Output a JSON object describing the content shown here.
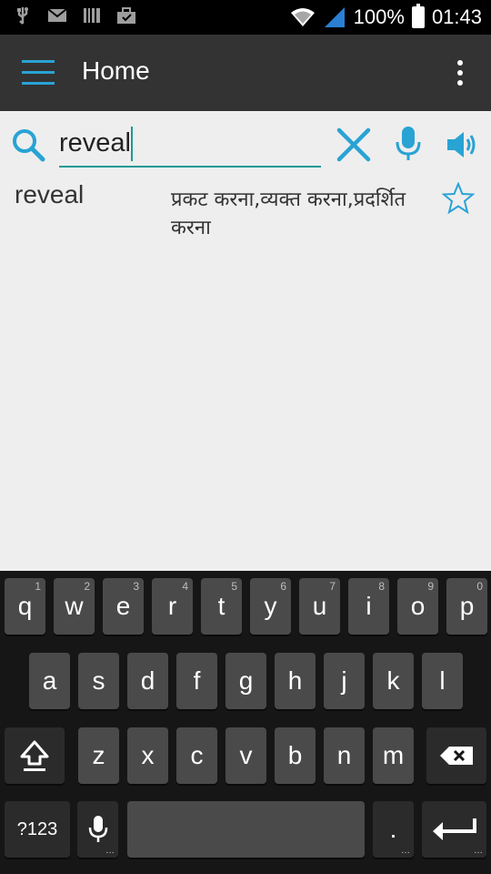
{
  "status_bar": {
    "battery": "100%",
    "time": "01:43",
    "icons": [
      "usb-icon",
      "mail-icon",
      "barcode-icon",
      "briefcase-icon",
      "wifi-icon",
      "signal-icon",
      "battery-icon"
    ]
  },
  "app_bar": {
    "title": "Home",
    "icons": [
      "menu-icon",
      "overflow-menu-icon"
    ]
  },
  "search": {
    "value": "reveal",
    "icons": [
      "search-icon",
      "clear-icon",
      "microphone-icon",
      "speaker-icon"
    ],
    "accent_color": "#1a9a96",
    "icon_color": "#29a3d4"
  },
  "result": {
    "word": "reveal",
    "meaning": "प्रकट करना,व्यक्त करना,प्रदर्शित करना",
    "favorite_icon": "star-outline-icon"
  },
  "keyboard": {
    "row1": [
      {
        "label": "q",
        "hint": "1"
      },
      {
        "label": "w",
        "hint": "2"
      },
      {
        "label": "e",
        "hint": "3"
      },
      {
        "label": "r",
        "hint": "4"
      },
      {
        "label": "t",
        "hint": "5"
      },
      {
        "label": "y",
        "hint": "6"
      },
      {
        "label": "u",
        "hint": "7"
      },
      {
        "label": "i",
        "hint": "8"
      },
      {
        "label": "o",
        "hint": "9"
      },
      {
        "label": "p",
        "hint": "0"
      }
    ],
    "row2": [
      "a",
      "s",
      "d",
      "f",
      "g",
      "h",
      "j",
      "k",
      "l"
    ],
    "row3": [
      "z",
      "x",
      "c",
      "v",
      "b",
      "n",
      "m"
    ],
    "symbols_label": "?123",
    "period_label": ".",
    "special_icons": [
      "shift-icon",
      "backspace-icon",
      "microphone-icon",
      "enter-icon"
    ]
  }
}
